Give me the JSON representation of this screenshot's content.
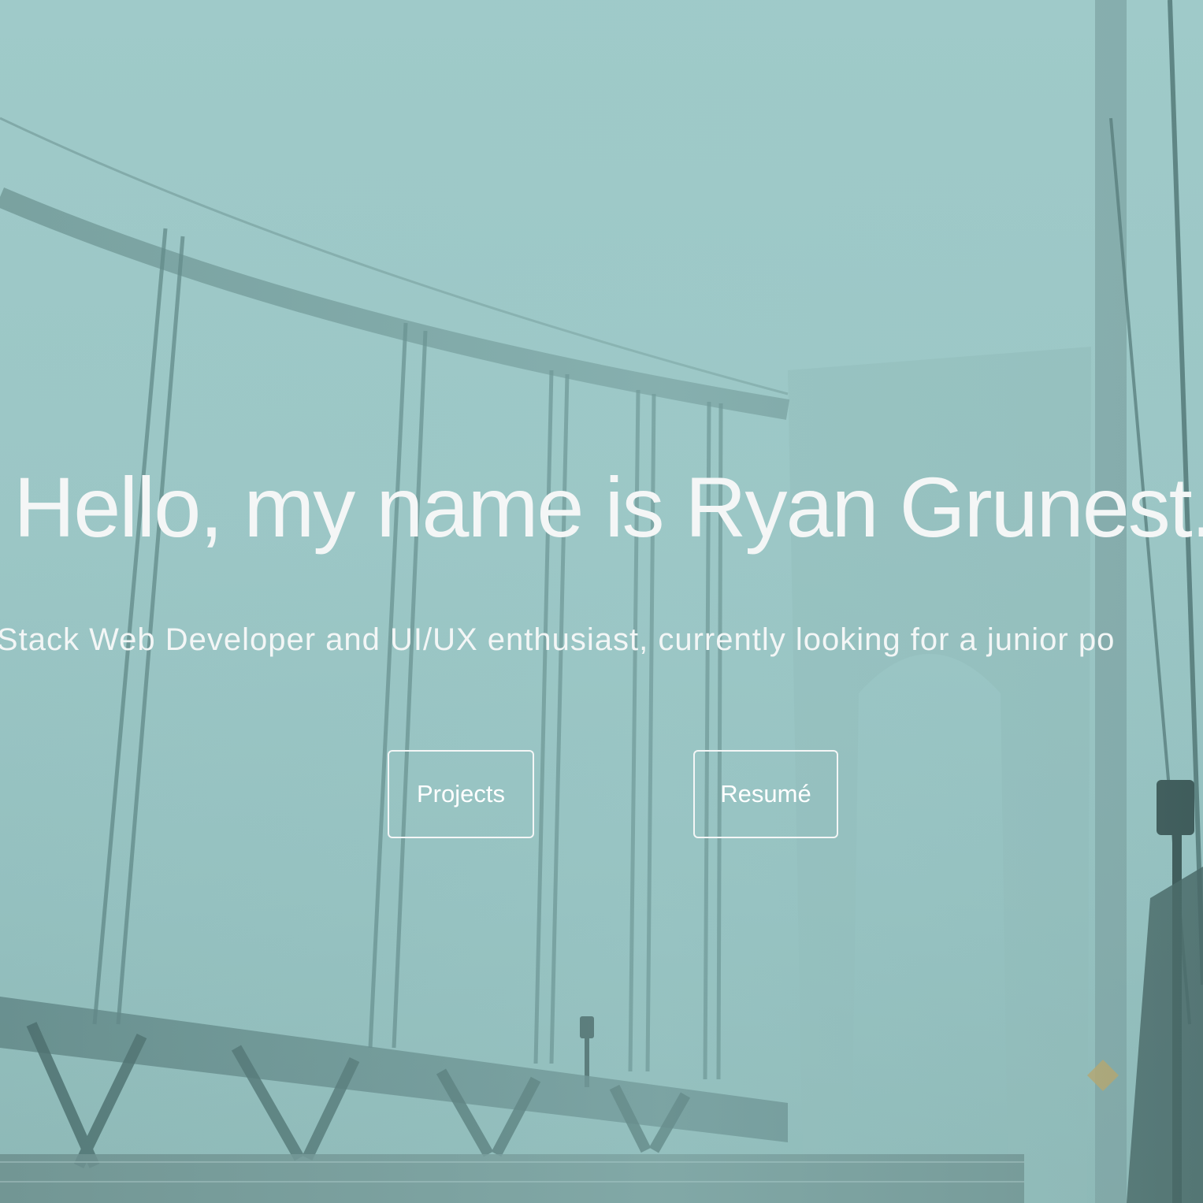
{
  "hero": {
    "title": "Hello, my name is Ryan Grunest.",
    "subtitle": "a Full Stack Web Developer and UI/UX enthusiast, currently looking for a junior po",
    "background": "foggy suspension bridge photo"
  },
  "buttons": {
    "projects_label": "Projects",
    "resume_label": "Resumé"
  },
  "colors": {
    "fog": "#9cc7c6",
    "text": "#f4f6f6",
    "bridge_dark": "#3f5c5b"
  }
}
